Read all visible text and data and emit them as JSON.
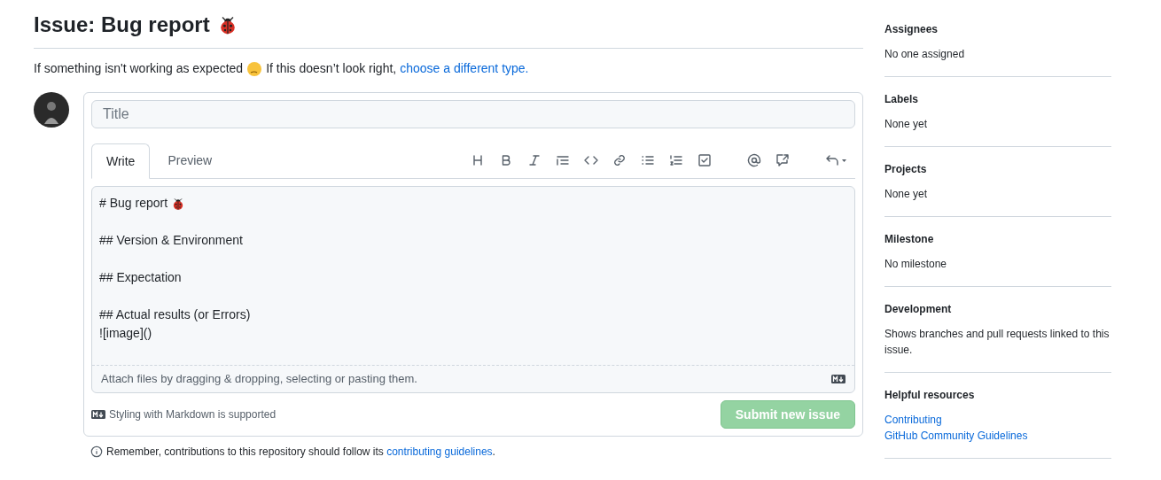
{
  "heading": {
    "text": "Issue: Bug report"
  },
  "intro": {
    "text": "If something isn't working as expected",
    "text_after": "If this doesn’t look right,",
    "link": "choose a different type."
  },
  "title_field": {
    "placeholder": "Title"
  },
  "tabs": [
    {
      "label": "Write",
      "selected": true
    },
    {
      "label": "Preview",
      "selected": false
    }
  ],
  "editor": {
    "lines": [
      {
        "kind": "text",
        "text": "# Bug report",
        "emoji": true
      },
      {
        "kind": "blank"
      },
      {
        "kind": "text",
        "text": "## Version & Environment",
        "emoji": false
      },
      {
        "kind": "blank"
      },
      {
        "kind": "text",
        "text": "## Expectation",
        "emoji": false
      },
      {
        "kind": "blank"
      },
      {
        "kind": "text",
        "text": "## Actual results (or Errors)",
        "emoji": false
      },
      {
        "kind": "text",
        "text": "![image]()",
        "emoji": false
      }
    ],
    "attach_hint": "Attach files by dragging & dropping, selecting or pasting them."
  },
  "markdown_note": "Styling with Markdown is supported",
  "submit": {
    "label": "Submit new issue",
    "disabled": true
  },
  "footer": {
    "text": "Remember, contributions to this repository should follow its",
    "link": "contributing guidelines",
    "after": "."
  },
  "sidebar": [
    {
      "title": "Assignees",
      "lines": [
        {
          "text": "No one assigned",
          "kind": "text"
        }
      ]
    },
    {
      "title": "Labels",
      "lines": [
        {
          "text": "None yet",
          "kind": "text"
        }
      ]
    },
    {
      "title": "Projects",
      "lines": [
        {
          "text": "None yet",
          "kind": "text"
        }
      ]
    },
    {
      "title": "Milestone",
      "lines": [
        {
          "text": "No milestone",
          "kind": "text"
        }
      ]
    },
    {
      "title": "Development",
      "lines": [
        {
          "text": "Shows branches and pull requests linked to this issue.",
          "kind": "text"
        }
      ]
    },
    {
      "title": "Helpful resources",
      "lines": [
        {
          "text": "Contributing",
          "kind": "link"
        },
        {
          "text": "GitHub Community Guidelines",
          "kind": "link"
        }
      ]
    }
  ]
}
